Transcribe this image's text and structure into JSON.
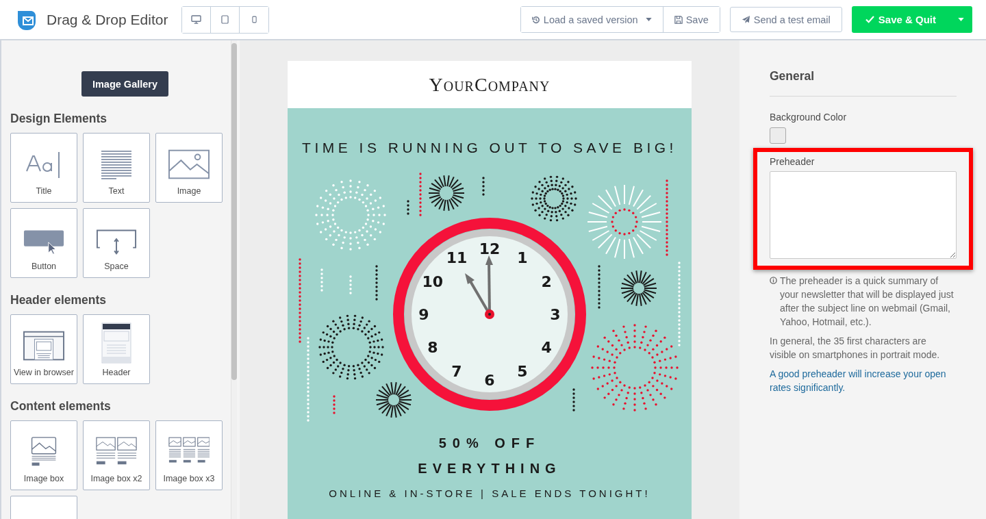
{
  "app": {
    "title": "Drag & Drop Editor"
  },
  "devices": [
    {
      "kind": "desktop"
    },
    {
      "kind": "tablet"
    },
    {
      "kind": "phone"
    }
  ],
  "toolbar": {
    "load_version": "Load a saved version",
    "save": "Save",
    "test_email": "Send a test email",
    "save_quit": "Save & Quit"
  },
  "sidebar": {
    "gallery_button": "Image Gallery",
    "sections": [
      {
        "title": "Design Elements",
        "tiles": [
          {
            "label": "Title",
            "kind": "title"
          },
          {
            "label": "Text",
            "kind": "text"
          },
          {
            "label": "Image",
            "kind": "image"
          },
          {
            "label": "Button",
            "kind": "button"
          },
          {
            "label": "Space",
            "kind": "space"
          }
        ]
      },
      {
        "title": "Header elements",
        "tiles": [
          {
            "label": "View in browser",
            "kind": "browser"
          },
          {
            "label": "Header",
            "kind": "header"
          }
        ]
      },
      {
        "title": "Content elements",
        "tiles": [
          {
            "label": "Image box",
            "kind": "imagebox"
          },
          {
            "label": "Image box x2",
            "kind": "imagebox2"
          },
          {
            "label": "Image box x3",
            "kind": "imagebox3"
          },
          {
            "kind": "blank"
          }
        ]
      }
    ]
  },
  "email": {
    "company": "YourCompany",
    "headline": "TIME IS RUNNING OUT TO SAVE BIG!",
    "clock_numbers": [
      "12",
      "1",
      "2",
      "3",
      "4",
      "5",
      "6",
      "7",
      "8",
      "9",
      "10",
      "11"
    ],
    "offer": "50% OFF",
    "offer_line2": "EVERYTHING",
    "footer": "ONLINE & IN-STORE | SALE ENDS TONIGHT!"
  },
  "settings": {
    "heading": "General",
    "background_color_label": "Background Color",
    "preheader_label": "Preheader",
    "help": [
      "The preheader is a quick summary of your newsletter that will be displayed just after the subject line on webmail (Gmail, Yahoo, Hotmail, etc.).",
      "In general, the 35 first characters are visible on smartphones in portrait mode."
    ],
    "link": "A good preheader will increase your open rates significantly."
  }
}
